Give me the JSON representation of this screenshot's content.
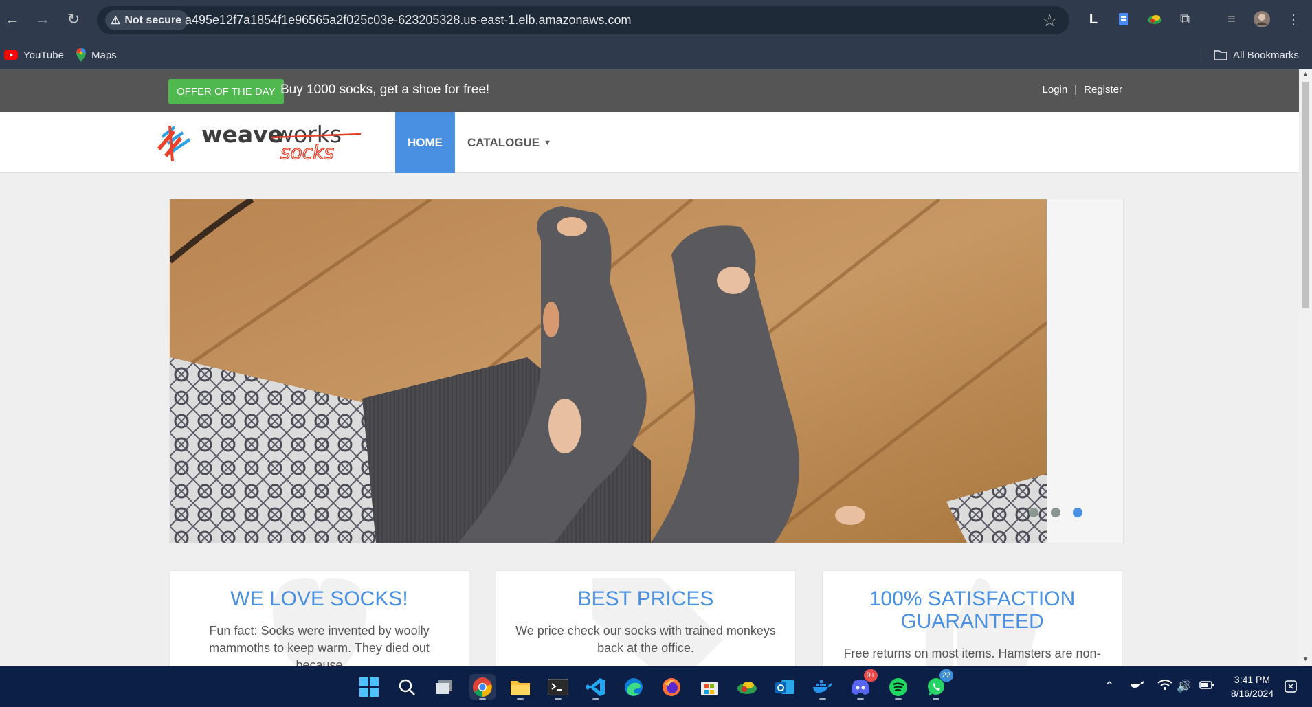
{
  "browser": {
    "security_label": "Not secure",
    "url": "a495e12f7a1854f1e96565a2f025c03e-623205328.us-east-1.elb.amazonaws.com",
    "bookmarks": [
      {
        "label": "YouTube",
        "icon": "youtube-icon"
      },
      {
        "label": "Maps",
        "icon": "maps-icon"
      }
    ],
    "all_bookmarks_label": "All Bookmarks",
    "profile_letter": "L"
  },
  "site": {
    "offer_badge": "OFFER OF THE DAY",
    "offer_text": "Buy 1000 socks, get a shoe for free!",
    "login_label": "Login",
    "separator": "|",
    "register_label": "Register",
    "logo_word1": "weave",
    "logo_word2": "works",
    "logo_word3": "socks",
    "nav": {
      "home": "HOME",
      "catalogue": "CATALOGUE"
    },
    "carousel": {
      "slides": 3,
      "active_slide": 3
    },
    "features": [
      {
        "title": "WE LOVE SOCKS!",
        "text": "Fun fact: Socks were invented by woolly mammoths to keep warm. They died out because"
      },
      {
        "title": "BEST PRICES",
        "text": "We price check our socks with trained monkeys back at the office."
      },
      {
        "title": "100% SATISFACTION GUARANTEED",
        "text": "Free returns on most items. Hamsters are non-"
      }
    ]
  },
  "taskbar": {
    "apps": [
      "windows-start",
      "search",
      "task-view",
      "chrome",
      "file-explorer",
      "terminal",
      "vscode",
      "edge",
      "firefox",
      "microsoft-store",
      "app-green",
      "outlook",
      "docker",
      "discord",
      "spotify",
      "whatsapp"
    ],
    "discord_badge": "9+",
    "whatsapp_badge": "22",
    "time": "3:41 PM",
    "date": "8/16/2024"
  },
  "colors": {
    "accent_blue": "#4a90e2",
    "offer_green": "#4fb84f",
    "topbar_grey": "#555555",
    "logo_red": "#e8412c"
  }
}
